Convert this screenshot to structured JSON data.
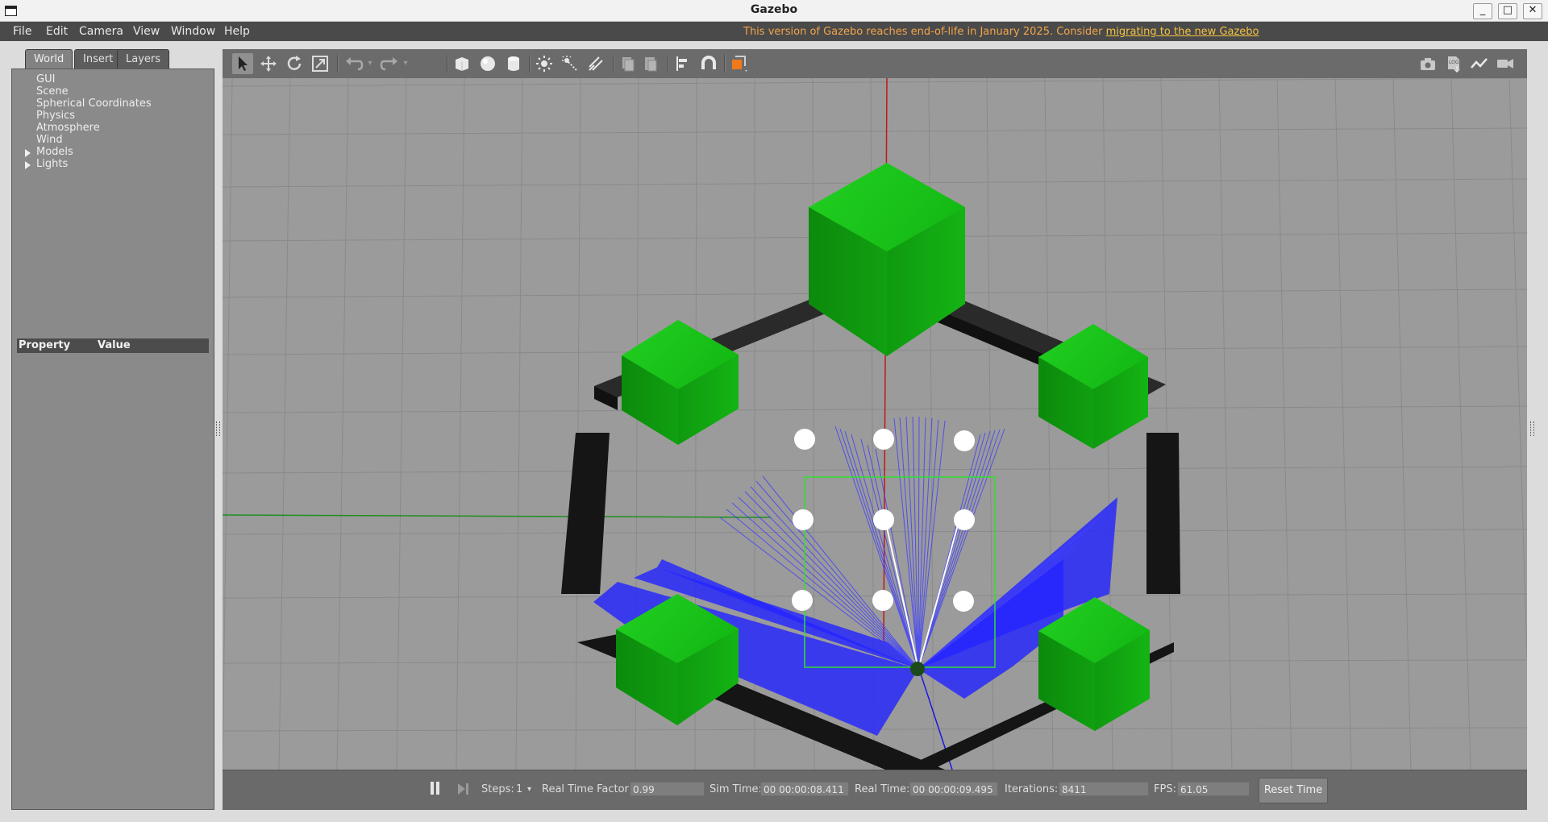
{
  "window": {
    "title": "Gazebo",
    "minimize": "_",
    "maximize": "□",
    "close": "✕"
  },
  "menu": {
    "items": [
      "File",
      "Edit",
      "Camera",
      "View",
      "Window",
      "Help"
    ],
    "notice_text": "This version of Gazebo reaches end-of-life in January 2025. Consider ",
    "notice_link": "migrating to the new Gazebo"
  },
  "left_panel": {
    "tabs": [
      "World",
      "Insert",
      "Layers"
    ],
    "tree": [
      "GUI",
      "Scene",
      "Spherical Coordinates",
      "Physics",
      "Atmosphere",
      "Wind",
      "Models",
      "Lights"
    ],
    "property_header": {
      "property": "Property",
      "value": "Value"
    }
  },
  "toolbar": {
    "icons": [
      "select-arrow-icon",
      "translate-icon",
      "rotate-icon",
      "scale-icon",
      "undo-icon",
      "redo-icon",
      "box-icon",
      "sphere-icon",
      "cylinder-icon",
      "point-light-icon",
      "spot-light-icon",
      "directional-light-icon",
      "copy-icon",
      "paste-icon",
      "align-icon",
      "snap-magnet-icon",
      "view-angle-icon",
      "screenshot-icon",
      "log-icon",
      "plot-icon",
      "video-record-icon"
    ]
  },
  "status": {
    "steps_label": "Steps:",
    "steps_value": "1",
    "rtf_label": "Real Time Factor:",
    "rtf_value": "0.99",
    "sim_time_label": "Sim Time:",
    "sim_time_value": "00 00:00:08.411",
    "real_time_label": "Real Time:",
    "real_time_value": "00 00:00:09.495",
    "iterations_label": "Iterations:",
    "iterations_value": "8411",
    "fps_label": "FPS:",
    "fps_value": "61.05",
    "reset_label": "Reset Time"
  },
  "colors": {
    "viewport_bg": "#9b9b9b",
    "obstacle_green": "#14b814",
    "wall_black": "#1a1a1a",
    "laser_blue": "#2020ff",
    "notice_orange": "#f2a54a"
  }
}
